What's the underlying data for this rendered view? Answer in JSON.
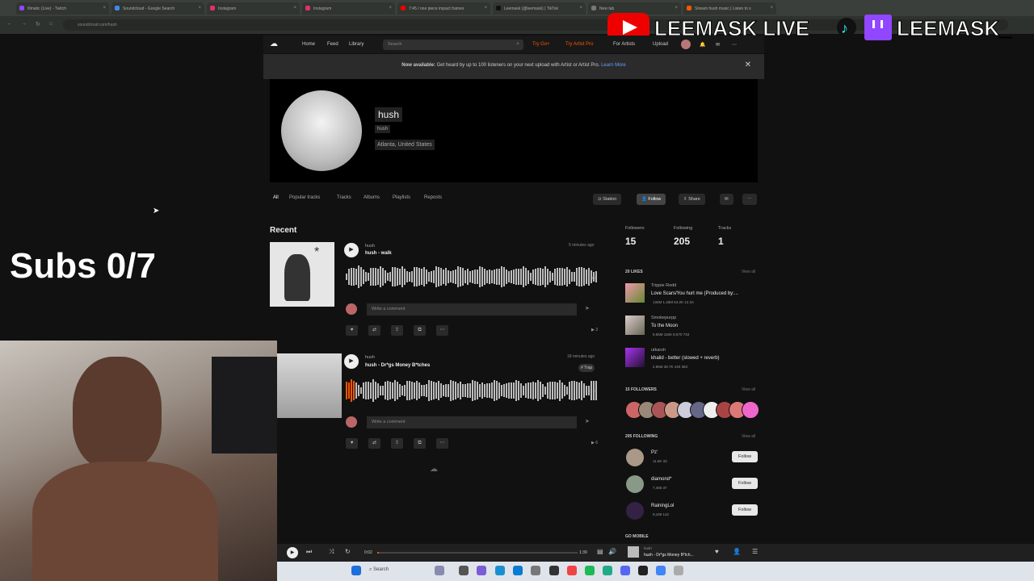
{
  "browser": {
    "tabs": [
      "Illmatic (Live) - Twitch",
      "Soundcloud - Google Search",
      "Instagram",
      "Instagram",
      "7:45 / one piece impact frames",
      "Leemask (@leemask) | TikTok",
      "New tab",
      "Stream hush music | Listen to s"
    ],
    "url": "soundcloud.com/hush"
  },
  "overlay": {
    "brand_text": "LEEMASK LIVE",
    "brand_text2": "LEEMASK_",
    "subs": "Subs 0/7"
  },
  "sc": {
    "nav": [
      "Home",
      "Feed",
      "Library"
    ],
    "search_placeholder": "Search",
    "try_go": "Try Go+",
    "try_pro": "Try Artist Pro",
    "for_artists": "For Artists",
    "upload": "Upload",
    "banner_bold": "Now available:",
    "banner_text": "Get heard by up to 100 listeners on your next upload with Artist or Artist Pro.",
    "banner_link": "Learn More",
    "profile": {
      "name": "hush",
      "subname": "hush",
      "location": "Atlanta, United States"
    },
    "tabs": [
      "All",
      "Popular tracks",
      "Tracks",
      "Albums",
      "Playlists",
      "Reposts"
    ],
    "actions": {
      "station": "Station",
      "follow": "Follow",
      "share": "Share"
    },
    "recent": "Recent",
    "tracks": [
      {
        "artist": "hush",
        "title": "hush - walk",
        "time": "5 minutes ago",
        "duration": "1:48",
        "plays": "3",
        "comment": "Write a comment"
      },
      {
        "artist": "hush",
        "title": "hush - Dr*gs Money B*tches",
        "time": "18 minutes ago",
        "tag": "# Trap",
        "duration": "1:39",
        "plays": "6",
        "comment": "Write a comment"
      }
    ],
    "stats": [
      {
        "label": "Followers",
        "value": "15"
      },
      {
        "label": "Following",
        "value": "205"
      },
      {
        "label": "Tracks",
        "value": "1"
      }
    ],
    "likes_header": "20 LIKES",
    "view_all": "View all",
    "likes": [
      {
        "artist": "Trippie Redd",
        "title": "Love Scars/You hurt me (Produced by:...",
        "stats": "134M  1.46M  64.2K  12.1K"
      },
      {
        "artist": "Smokepurpp",
        "title": "To the Moon",
        "stats": "8.55M  116K  8,570  734"
      },
      {
        "artist": "utkarsh",
        "title": "khalid - better (slowed + reverb)",
        "stats": "2.86M  38.7K  440  383"
      }
    ],
    "followers_header": "15 FOLLOWERS",
    "following_header": "205 FOLLOWING",
    "following": [
      {
        "name": "Pz'",
        "stats": "11.6K  33",
        "btn": "Follow"
      },
      {
        "name": "diamond*",
        "stats": "7,456  37",
        "btn": "Follow"
      },
      {
        "name": "RainingLol",
        "stats": "9,169  142",
        "btn": "Follow"
      }
    ],
    "go_mobile": "GO MOBILE",
    "player": {
      "elapsed": "0:02",
      "total": "1:39",
      "artist": "hush",
      "title": "hush - Dr*gs Money B*tch..."
    }
  },
  "taskbar": {
    "search": "Search"
  }
}
